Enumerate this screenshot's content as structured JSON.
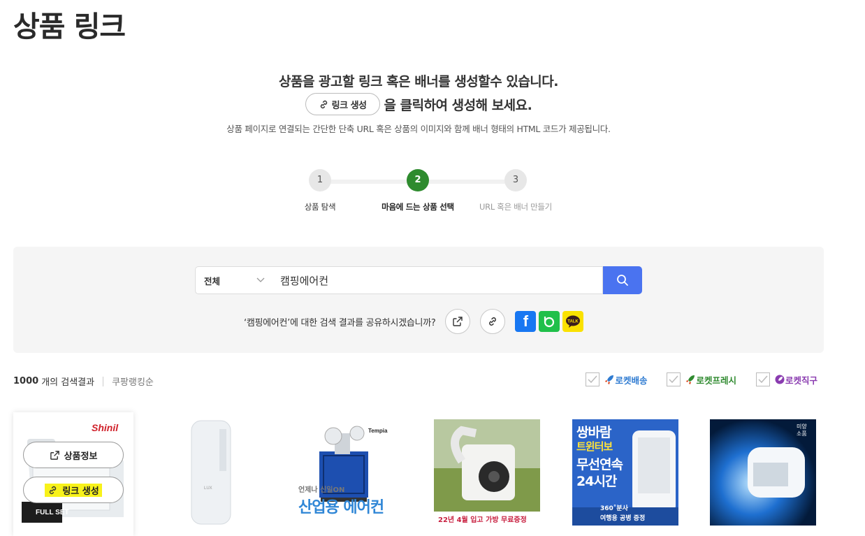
{
  "page": {
    "title": "상품 링크"
  },
  "intro": {
    "line1": "상품을 광고할 링크 혹은 배너를 생성할수 있습니다.",
    "link_button": "링크 생성",
    "line2_suffix": "을 클릭하여 생성해 보세요.",
    "line3": "상품 페이지로 연결되는 간단한 단축 URL 혹은 상품의 이미지와 함께 배너 형태의 HTML 코드가 제공됩니다."
  },
  "steps": [
    {
      "number": "1",
      "label": "상품 탐색",
      "state": "done"
    },
    {
      "number": "2",
      "label": "마음에 드는 상품 선택",
      "state": "active"
    },
    {
      "number": "3",
      "label": "URL 혹은 배너 만들기",
      "state": "pending"
    }
  ],
  "search": {
    "category": "전체",
    "query": "캠핑에어컨",
    "share_text": "‘캠핑에어컨’에 대한 검색 결과를 공유하시겠습니까?"
  },
  "results": {
    "count": "1000",
    "count_suffix": "개의 검색결과",
    "sort": "쿠팡랭킹순"
  },
  "filters": [
    {
      "label": "로켓배송",
      "checked": true,
      "color": "#2f7bd1"
    },
    {
      "label": "로켓프레시",
      "checked": true,
      "color": "#2f8a2f"
    },
    {
      "label": "로켓직구",
      "checked": true,
      "color": "#8a3cb0"
    }
  ],
  "products": [
    {
      "brand": "Shinil",
      "badge": "FULL SET",
      "hover_info": "상품정보",
      "hover_link": "링크 생성"
    },
    {
      "brand": "LUX"
    },
    {
      "brand": "Tempia",
      "caption_small": "언제나 신일ON",
      "caption_big": "산업용 에어컨"
    },
    {
      "caption": "22년 4월 입고 가방 무료증정"
    },
    {
      "headline": [
        "쌍바람",
        "트윈터보",
        "무선연속",
        "24시간"
      ],
      "badge": "360˚분사",
      "caption": "여행용 공병 증정"
    },
    {
      "tag": "미양소품"
    }
  ],
  "colors": {
    "accent_green": "#2e8b2e",
    "search_blue": "#4a73f0",
    "highlight_yellow": "#f8f21a"
  }
}
